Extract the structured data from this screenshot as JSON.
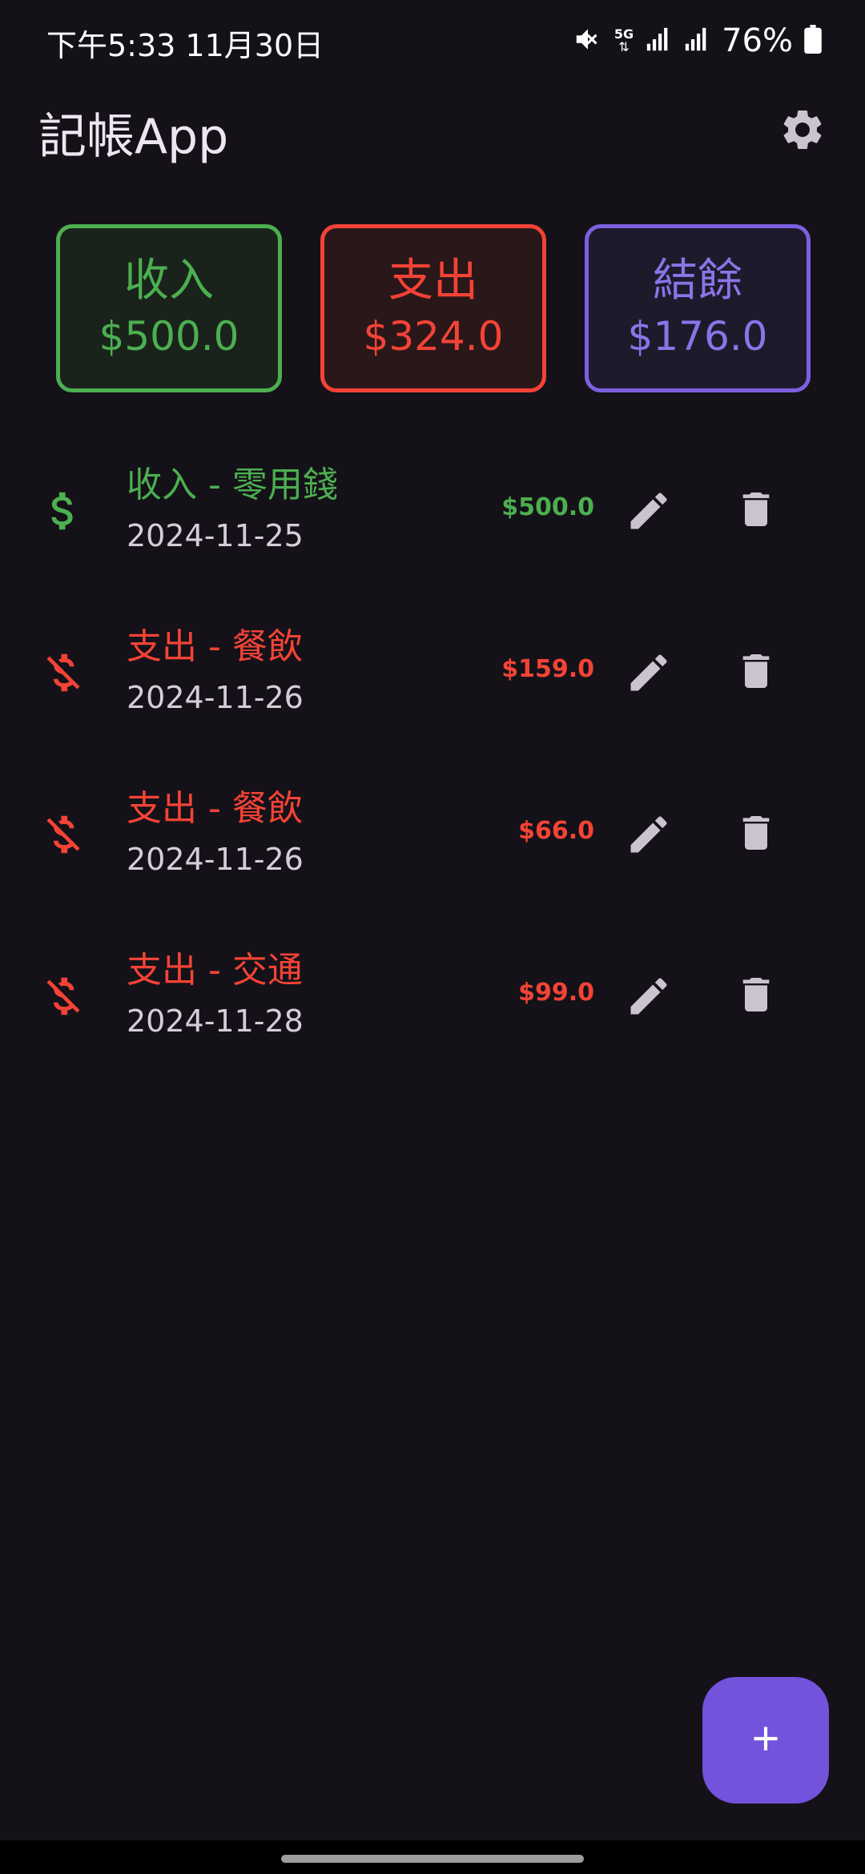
{
  "status_bar": {
    "time_date": "下午5:33   11月30日",
    "network": "5G",
    "battery": "76%"
  },
  "app_bar": {
    "title": "記帳App",
    "settings_icon": "gear-icon"
  },
  "summary": {
    "income": {
      "label": "收入",
      "value": "$500.0",
      "color": "#4caf50"
    },
    "expense": {
      "label": "支出",
      "value": "$324.0",
      "color": "#f44336"
    },
    "balance": {
      "label": "結餘",
      "value": "$176.0",
      "color": "#7b61e0"
    }
  },
  "transactions": [
    {
      "type": "income",
      "icon": "dollar-icon",
      "title": "收入 - 零用錢",
      "date": "2024-11-25",
      "amount": "$500.0"
    },
    {
      "type": "expense",
      "icon": "money-off-icon",
      "title": "支出 - 餐飲",
      "date": "2024-11-26",
      "amount": "$159.0"
    },
    {
      "type": "expense",
      "icon": "money-off-icon",
      "title": "支出 - 餐飲",
      "date": "2024-11-26",
      "amount": "$66.0"
    },
    {
      "type": "expense",
      "icon": "money-off-icon",
      "title": "支出 - 交通",
      "date": "2024-11-28",
      "amount": "$99.0"
    }
  ],
  "fab": {
    "icon": "plus-icon"
  },
  "colors": {
    "background": "#141218",
    "income": "#4caf50",
    "expense": "#f44336",
    "accent": "#7352dc"
  }
}
